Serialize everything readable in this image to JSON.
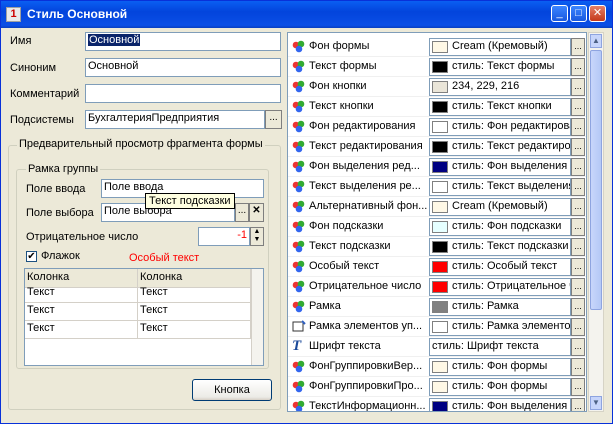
{
  "window": {
    "title": "Стиль Основной",
    "icon": "1c-icon",
    "controls": [
      "minimize-icon",
      "maximize-icon",
      "close-icon"
    ]
  },
  "form": {
    "name_label": "Имя",
    "name_value": "Основной",
    "synonym_label": "Синоним",
    "synonym_value": "Основной",
    "comment_label": "Комментарий",
    "comment_value": "",
    "subsystems_label": "Подсистемы",
    "subsystems_value": "БухгалтерияПредприятия"
  },
  "preview": {
    "title": "Предварительный просмотр фрагмента формы",
    "group_title": "Рамка группы",
    "input_label": "Поле ввода",
    "input_value": "Поле ввода",
    "tooltip": "Текст подсказки",
    "select_label": "Поле выбора",
    "select_value": "Поле выбора",
    "negative_label": "Отрицательное число",
    "negative_value": "-1",
    "checkbox_label": "Флажок",
    "special_text": "Особый текст",
    "table_headers": [
      "Колонка",
      "Колонка"
    ],
    "table_rows": [
      [
        "Текст",
        "Текст"
      ],
      [
        "Текст",
        "Текст"
      ],
      [
        "Текст",
        "Текст"
      ]
    ],
    "button_label": "Кнопка"
  },
  "properties": [
    {
      "name": "Фон формы",
      "value": "Cream (Кремовый)",
      "color": "#fff8e6",
      "icon": "palette-icon"
    },
    {
      "name": "Текст формы",
      "value": "стиль: Текст формы",
      "color": "#000000",
      "icon": "palette-icon"
    },
    {
      "name": "Фон кнопки",
      "value": "234, 229, 216",
      "color": "#eae5d8",
      "icon": "palette-icon"
    },
    {
      "name": "Текст кнопки",
      "value": "стиль: Текст кнопки",
      "color": "#000000",
      "icon": "palette-icon"
    },
    {
      "name": "Фон редактирования",
      "value": "стиль: Фон редактирования",
      "color": "#ffffff",
      "icon": "palette-icon"
    },
    {
      "name": "Текст редактирования",
      "value": "стиль: Текст редактирования",
      "color": "#000000",
      "icon": "palette-icon"
    },
    {
      "name": "Фон выделения ред...",
      "value": "стиль: Фон выделения",
      "color": "#000080",
      "icon": "palette-icon"
    },
    {
      "name": "Текст выделения ре...",
      "value": "стиль: Текст выделения",
      "color": "#ffffff",
      "icon": "palette-icon"
    },
    {
      "name": "Альтернативный фон...",
      "value": "Cream (Кремовый)",
      "color": "#fff8e6",
      "icon": "palette-icon"
    },
    {
      "name": "Фон подсказки",
      "value": "стиль: Фон подсказки",
      "color": "#e6ffff",
      "icon": "palette-icon"
    },
    {
      "name": "Текст подсказки",
      "value": "стиль: Текст подсказки",
      "color": "#000000",
      "icon": "palette-icon"
    },
    {
      "name": "Особый текст",
      "value": "стиль: Особый текст",
      "color": "#ff0000",
      "icon": "palette-icon"
    },
    {
      "name": "Отрицательное число",
      "value": "стиль: Отрицательное число",
      "color": "#ff0000",
      "icon": "palette-icon"
    },
    {
      "name": "Рамка",
      "value": "стиль: Рамка",
      "color": "#808080",
      "icon": "palette-icon"
    },
    {
      "name": "Рамка элементов уп...",
      "value": "стиль: Рамка элементов",
      "color": "#ffffff",
      "icon": "frame-icon"
    },
    {
      "name": "Шрифт текста",
      "value": "стиль: Шрифт текста",
      "color": "",
      "icon": "font-icon"
    },
    {
      "name": "ФонГруппировкиВер...",
      "value": "стиль: Фон формы",
      "color": "#fff8e6",
      "icon": "palette-icon"
    },
    {
      "name": "ФонГруппировкиПро...",
      "value": "стиль: Фон формы",
      "color": "#fff8e6",
      "icon": "palette-icon"
    },
    {
      "name": "ТекстИнформационн...",
      "value": "стиль: Фон выделения",
      "color": "#000080",
      "icon": "palette-icon"
    }
  ],
  "icons": {
    "palette": "palette-icon",
    "font": "font-icon",
    "frame": "frame-icon"
  }
}
